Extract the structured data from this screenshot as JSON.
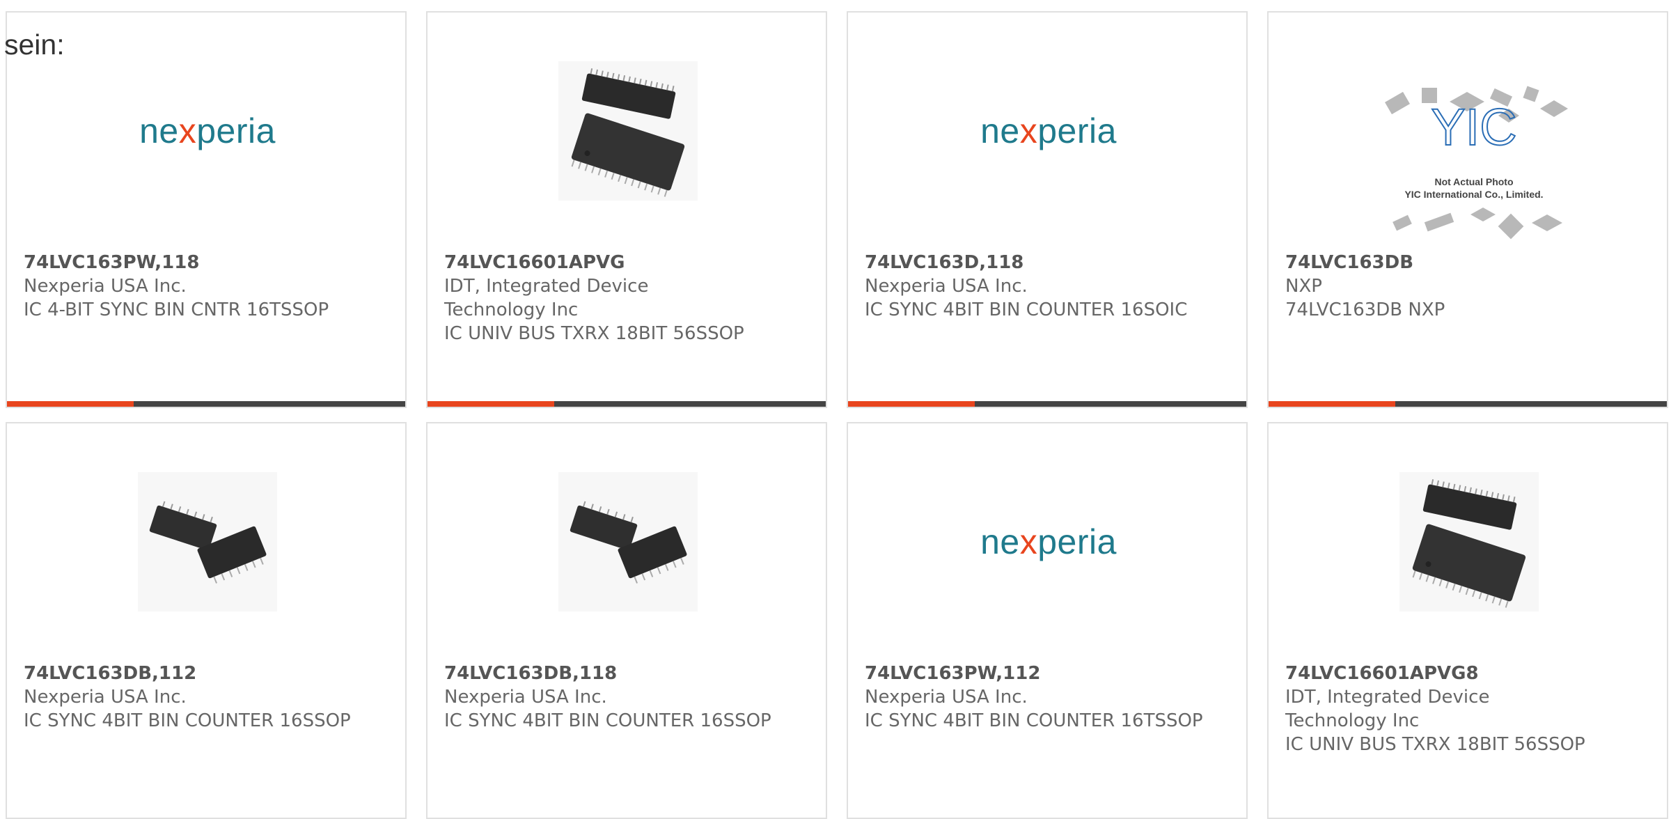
{
  "intro_text": "sein:",
  "brand_logo": {
    "name": "nexperia",
    "parts": [
      "ne",
      "x",
      "peria"
    ]
  },
  "yic_placeholder": {
    "logo": "YIC",
    "line1": "Not Actual Photo",
    "line2": "YIC International Co., Limited."
  },
  "colors": {
    "accent": "#e8451e",
    "bar": "#444444",
    "brand_teal": "#1f7a8c"
  },
  "products": [
    {
      "part": "74LVC163PW,118",
      "mfr": "Nexperia USA Inc.",
      "desc": "IC 4-BIT SYNC BIN CNTR 16TSSOP",
      "image": "nexperia-logo",
      "has_bar": true
    },
    {
      "part": "74LVC16601APVG",
      "mfr": "IDT, Integrated Device Technology Inc",
      "desc": "IC UNIV BUS TXRX 18BIT 56SSOP",
      "image": "ssop56-chip",
      "has_bar": true
    },
    {
      "part": "74LVC163D,118",
      "mfr": "Nexperia USA Inc.",
      "desc": "IC SYNC 4BIT BIN COUNTER 16SOIC",
      "image": "nexperia-logo",
      "has_bar": true
    },
    {
      "part": "74LVC163DB",
      "mfr": "NXP",
      "desc": "74LVC163DB NXP",
      "image": "yic-placeholder",
      "has_bar": true
    },
    {
      "part": "74LVC163DB,112",
      "mfr": "Nexperia USA Inc.",
      "desc": "IC SYNC 4BIT BIN COUNTER 16SSOP",
      "image": "ssop16-chips",
      "has_bar": false
    },
    {
      "part": "74LVC163DB,118",
      "mfr": "Nexperia USA Inc.",
      "desc": "IC SYNC 4BIT BIN COUNTER 16SSOP",
      "image": "ssop16-chips",
      "has_bar": false
    },
    {
      "part": "74LVC163PW,112",
      "mfr": "Nexperia USA Inc.",
      "desc": "IC SYNC 4BIT BIN COUNTER 16TSSOP",
      "image": "nexperia-logo",
      "has_bar": false
    },
    {
      "part": "74LVC16601APVG8",
      "mfr": "IDT, Integrated Device Technology Inc",
      "desc": "IC UNIV BUS TXRX 18BIT 56SSOP",
      "image": "ssop56-chip",
      "has_bar": false
    }
  ]
}
